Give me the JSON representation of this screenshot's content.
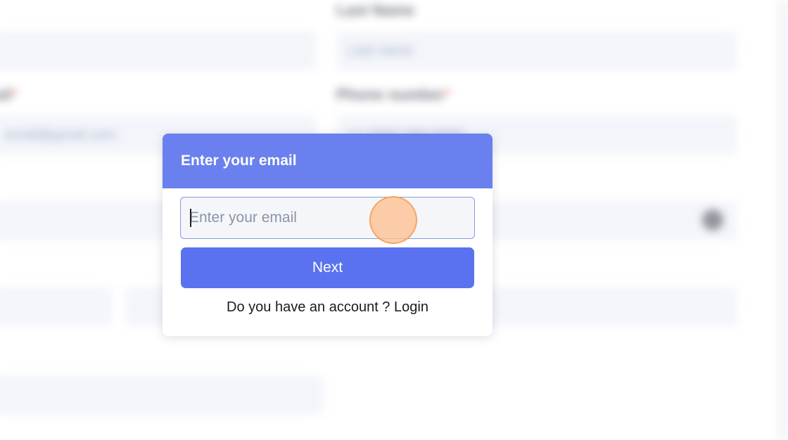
{
  "background_form": {
    "label_last_name": "Last Name",
    "placeholder_last_name": "Last name",
    "label_phone": "Phone number",
    "label_email_fragment": "ail",
    "value_email_fragment": "email@gmail.com",
    "value_phone_fragment": "+1 (555) 000-0000",
    "required_mark": "*"
  },
  "modal": {
    "title": "Enter your email",
    "email_placeholder": "Enter your email",
    "next_label": "Next",
    "account_prompt": "Do you have an account ? ",
    "login_label": "Login"
  },
  "colors": {
    "header": "#6a80ee",
    "primary_button": "#5a72ef",
    "click_indicator": "#ffbe8c"
  }
}
